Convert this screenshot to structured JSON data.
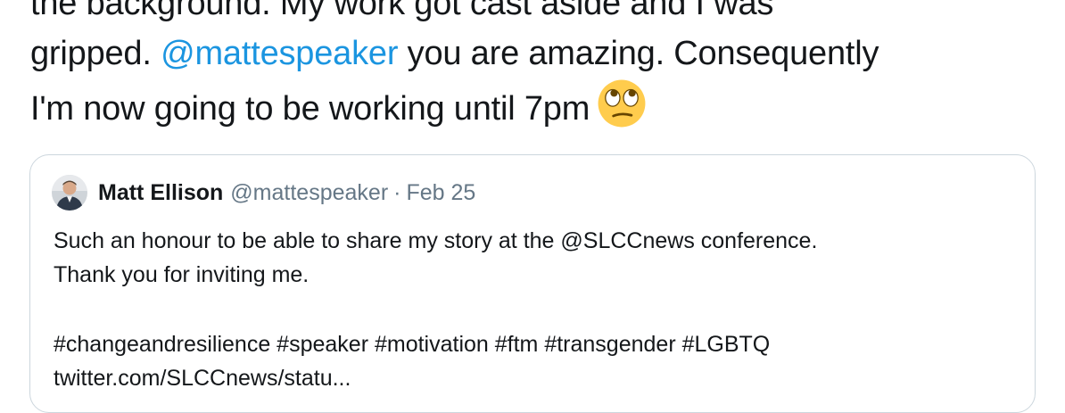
{
  "tweet": {
    "line1": "the background. My work got cast aside and I was",
    "line2_pre": "gripped. ",
    "line2_mention": "@mattespeaker",
    "line2_post": " you are amazing. Consequently",
    "line3": "I'm now going to be working until 7pm",
    "emoji": "face-with-rolling-eyes-emoji"
  },
  "quote": {
    "author_name": "Matt Ellison",
    "author_handle": "@mattespeaker",
    "separator": "·",
    "date": "Feb 25",
    "body_line1": "Such an honour to be able to share my story at the @SLCCnews conference.",
    "body_line2": "Thank you for inviting me.",
    "hashtags": "#changeandresilience #speaker #motivation #ftm #transgender #LGBTQ",
    "link": "twitter.com/SLCCnews/statu..."
  },
  "colors": {
    "text": "#14171a",
    "mention": "#1b95e0",
    "muted": "#657786",
    "border": "#ccd6dd"
  }
}
